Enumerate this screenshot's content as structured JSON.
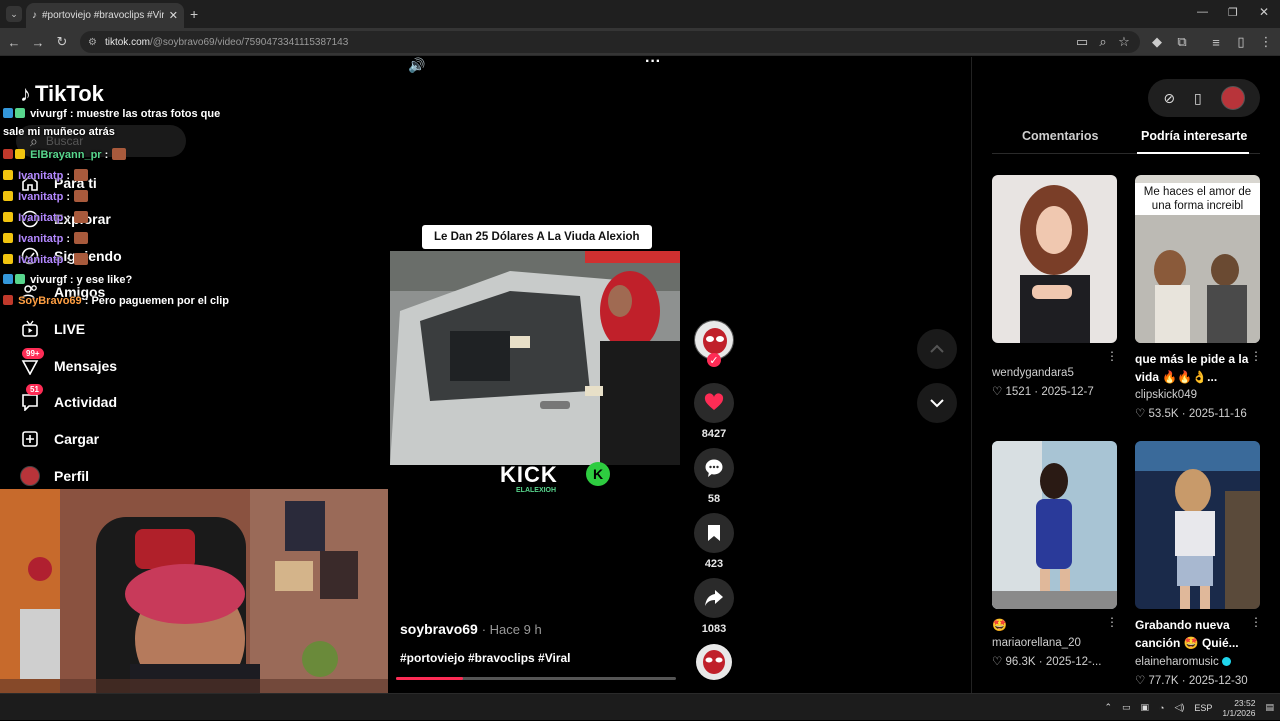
{
  "browser": {
    "tab_title": "#portoviejo #bravoclips #Viral | ",
    "url_host": "tiktok.com",
    "url_path": "/@soybravo69/video/7590473341115387143"
  },
  "sidebar": {
    "logo": "TikTok",
    "search_placeholder": "Buscar",
    "items": [
      {
        "label": "Para ti",
        "icon": "home-icon"
      },
      {
        "label": "Explorar",
        "icon": "compass-icon"
      },
      {
        "label": "Siguiendo",
        "icon": "following-icon"
      },
      {
        "label": "Amigos",
        "icon": "friends-icon"
      },
      {
        "label": "LIVE",
        "icon": "live-icon"
      },
      {
        "label": "Mensajes",
        "icon": "inbox-icon",
        "badge": "99+"
      },
      {
        "label": "Actividad",
        "icon": "activity-icon",
        "badge": "51"
      },
      {
        "label": "Cargar",
        "icon": "upload-icon"
      },
      {
        "label": "Perfil",
        "icon": "profile-icon"
      }
    ]
  },
  "chat": [
    {
      "user": "vivurgf",
      "text": ": muestre las otras fotos que",
      "color": "#ffffff"
    },
    {
      "user": "",
      "text": "sale mi muñeco atrás",
      "color": "#ffffff"
    },
    {
      "user": "ElBrayann_pr",
      "text": ":",
      "color": "#58d68d"
    },
    {
      "user": "Ivanitatp",
      "text": ":",
      "color": "#b388ff"
    },
    {
      "user": "Ivanitatp",
      "text": ":",
      "color": "#b388ff"
    },
    {
      "user": "Ivanitatp",
      "text": ":",
      "color": "#b388ff"
    },
    {
      "user": "Ivanitatp",
      "text": ":",
      "color": "#b388ff"
    },
    {
      "user": "Ivanitatp",
      "text": ":",
      "color": "#b388ff"
    },
    {
      "user": "vivurgf",
      "text": ": y ese like?",
      "color": "#ffffff"
    },
    {
      "user": "SoyBravo69",
      "text": ": Pero paguemen por el clip",
      "color": "#ff9f43"
    }
  ],
  "video": {
    "title_overlay": "Le Dan 25 Dólares A La Viuda Alexioh",
    "kick_text": "KICK",
    "kick_sub": "ELALEXIOH",
    "kick_logo": "K",
    "author": "soybravo69",
    "time": "· Hace 9 h",
    "hashtags": "#portoviejo #bravoclips #Viral",
    "progress": 0.24
  },
  "actions": {
    "likes": "8427",
    "comments": "58",
    "saves": "423",
    "shares": "1083"
  },
  "right_panel": {
    "tab_comments": "Comentarios",
    "tab_related": "Podría interesarte",
    "cards": [
      {
        "caption": "",
        "user": "wendygandara5",
        "likes": "1521",
        "date": "2025-12-7",
        "overlay": ""
      },
      {
        "caption": "que más le pide a la vida 🔥🔥👌...",
        "user": "clipskick049",
        "likes": "53.5K",
        "date": "2025-11-16",
        "overlay": "Me haces el amor de una forma increibl"
      },
      {
        "caption": "🤩",
        "user": "mariaorellana_20",
        "likes": "96.3K",
        "date": "2025-12-...",
        "overlay": ""
      },
      {
        "caption": "Grabando nueva canción 🤩 Quié...",
        "user": "elaineharomusic",
        "likes": "77.7K",
        "date": "2025-12-30",
        "overlay": ""
      }
    ]
  },
  "taskbar": {
    "lang": "ESP",
    "time": "23:52",
    "date": "1/1/2026"
  }
}
